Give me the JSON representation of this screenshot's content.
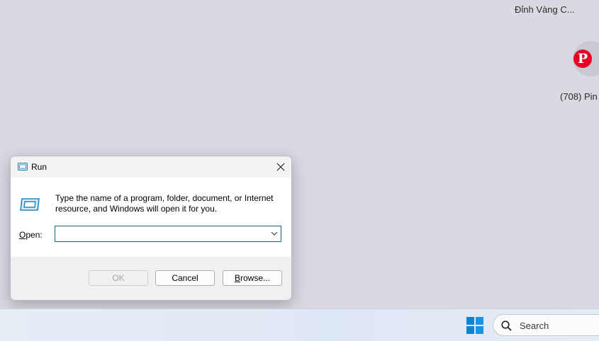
{
  "desktop": {
    "top_tile_label": "Đỉnh Vàng C...",
    "pinterest_label": "(708) Pin",
    "pinterest_glyph": "P"
  },
  "run_dialog": {
    "title": "Run",
    "description": "Type the name of a program, folder, document, or Internet resource, and Windows will open it for you.",
    "open_label_prefix": "",
    "open_label_mnemonic": "O",
    "open_label_rest": "pen:",
    "open_value": "",
    "ok_label": "OK",
    "cancel_label": "Cancel",
    "browse_label_mnemonic": "B",
    "browse_label_rest": "rowse..."
  },
  "taskbar": {
    "search_placeholder": "Search"
  },
  "colors": {
    "desktop_bg": "#d9d9e1",
    "pinterest_red": "#e60023",
    "windows_blue": "#0078d4",
    "input_border": "#0a6c8a"
  }
}
